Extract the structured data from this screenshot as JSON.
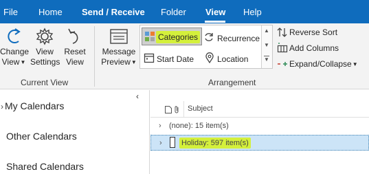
{
  "tabs": {
    "file": "File",
    "home": "Home",
    "send_receive": "Send / Receive",
    "folder": "Folder",
    "view": "View",
    "help": "Help"
  },
  "ribbon": {
    "current_view": {
      "change_view": [
        "Change",
        "View"
      ],
      "view_settings": [
        "View",
        "Settings"
      ],
      "reset_view": [
        "Reset",
        "View"
      ],
      "group_label": "Current View"
    },
    "arrangement": {
      "message_preview": [
        "Message",
        "Preview"
      ],
      "gallery": {
        "categories": "Categories",
        "recurrence": "Recurrence",
        "start_date": "Start Date",
        "location": "Location"
      },
      "reverse_sort": "Reverse Sort",
      "add_columns": "Add Columns",
      "expand_collapse": "Expand/Collapse",
      "group_label": "Arrangement"
    }
  },
  "nav": {
    "my_calendars": "My Calendars",
    "other_calendars": "Other Calendars",
    "shared_calendars": "Shared Calendars"
  },
  "list": {
    "header_subject": "Subject",
    "rows": [
      {
        "text": "(none): 15 item(s)"
      },
      {
        "text": "Holiday: 597 item(s)"
      }
    ]
  },
  "colors": {
    "accent": "#0f6cbd",
    "highlight": "#d4f03b",
    "selected_row": "#cce4f7"
  }
}
